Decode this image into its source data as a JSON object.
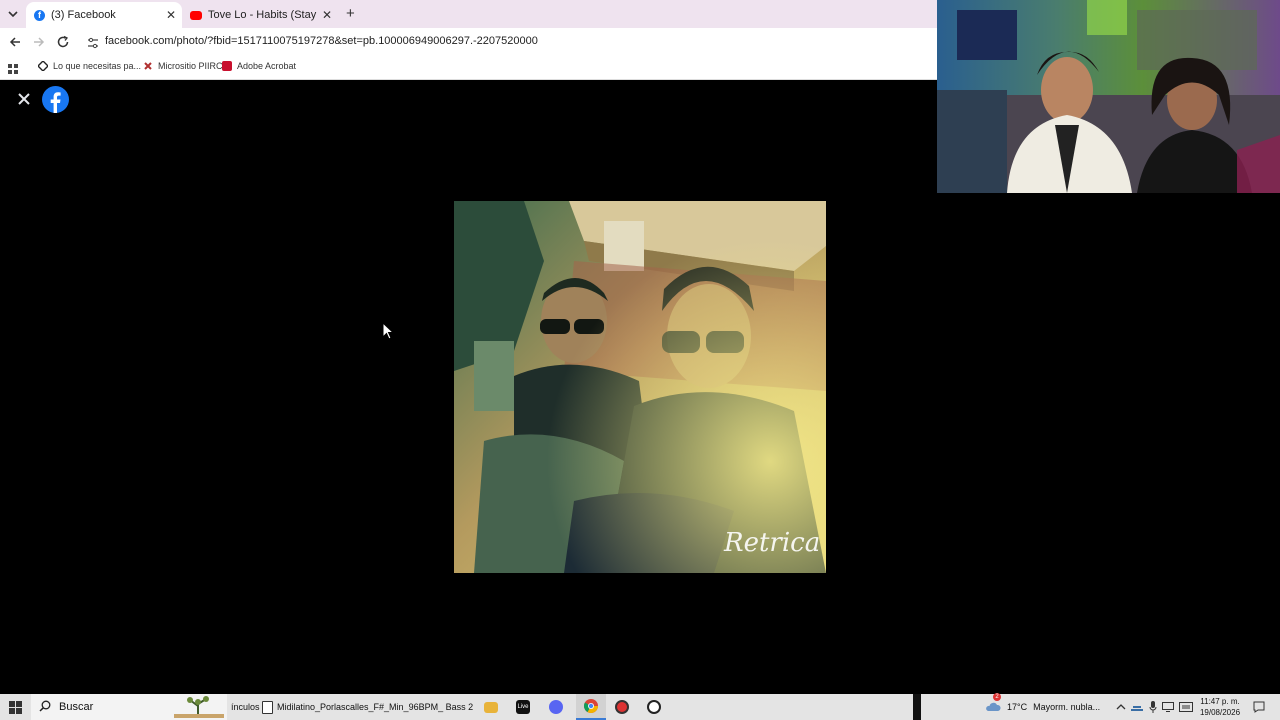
{
  "browser": {
    "tabs": [
      {
        "title": "(3) Facebook",
        "active": true
      },
      {
        "title": "Tove Lo - Habits (Stay High) - H",
        "active": false
      }
    ],
    "url": "facebook.com/photo/?fbid=1517110075197278&set=pb.100006949006297.-2207520000",
    "bookmarks": [
      {
        "label": "Lo que necesitas pa..."
      },
      {
        "label": "Micrositio PIIRC"
      },
      {
        "label": "Adobe Acrobat"
      }
    ]
  },
  "viewer": {
    "watermark": "Retrica"
  },
  "taskbar": {
    "search_placeholder": "Buscar",
    "partial_label": "ínculos",
    "open_window": "Midilatino_Porlascalles_F#_Min_96BPM_ Bass 2",
    "weather": "17°C",
    "weather_desc": "Mayorm. nubla...",
    "notification_count": "2",
    "time": "11:47 p. m.",
    "date": "19/08/2026"
  },
  "colors": {
    "facebook_blue": "#1877f2",
    "youtube_red": "#ff0000",
    "tabstrip_bg": "#efe3ef",
    "viewer_bg": "#000000"
  }
}
